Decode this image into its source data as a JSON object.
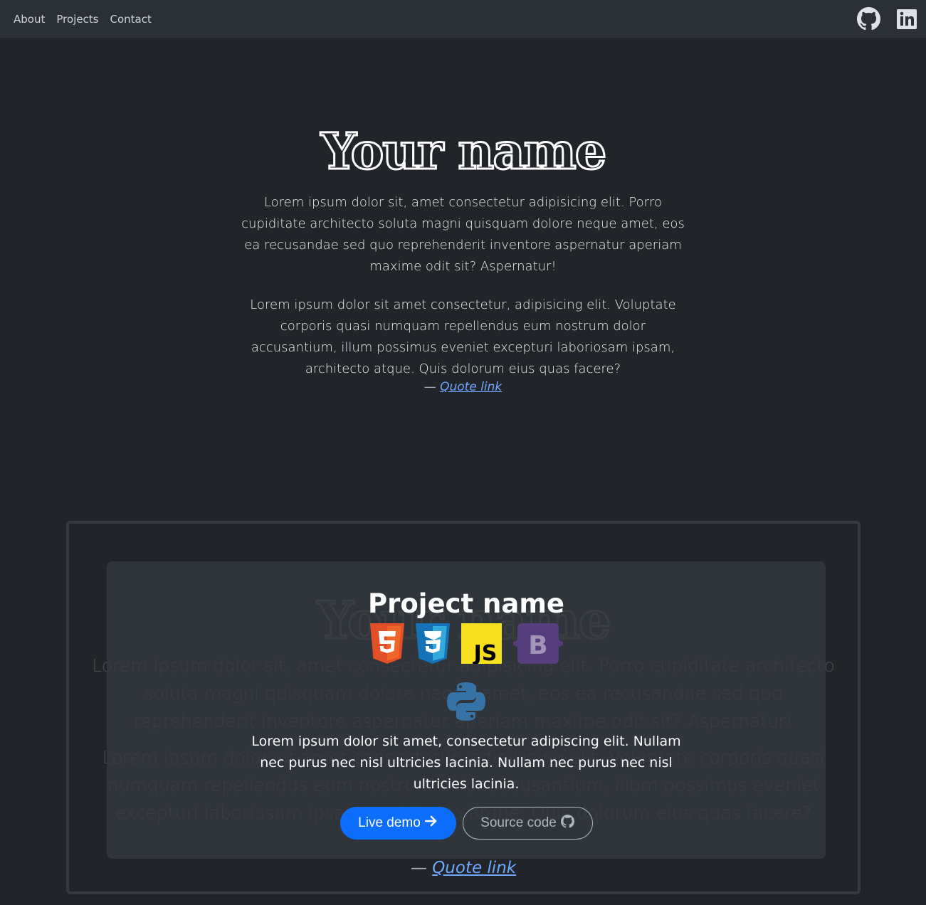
{
  "nav": {
    "links": [
      "About",
      "Projects",
      "Contact"
    ],
    "icons": [
      "github-icon",
      "linkedin-icon"
    ]
  },
  "hero": {
    "name": "Your name",
    "paragraph1": "Lorem ipsum dolor sit, amet consectetur adipisicing elit. Porro cupiditate architecto soluta magni quisquam dolore neque amet, eos ea recusandae sed quo reprehenderit inventore aspernatur aperiam maxime odit sit? Aspernatur!",
    "paragraph2": "Lorem ipsum dolor sit amet consectetur, adipisicing elit. Voluptate corporis quasi numquam repellendus eum nostrum dolor accusantium, illum possimus eveniet excepturi laboriosam ipsam, architecto atque. Quis dolorum eius quas facere?",
    "quote_dash": "—",
    "quote_link": "Quote link"
  },
  "project": {
    "title": "Project name",
    "tech_icons": [
      "html5-icon",
      "css3-icon",
      "javascript-icon",
      "bootstrap-icon",
      "python-icon"
    ],
    "description": "Lorem ipsum dolor sit amet, consectetur adipiscing elit. Nullam nec purus nec nisl ultricies lacinia. Nullam nec purus nec nisl ultricies lacinia.",
    "live_demo_label": "Live demo",
    "source_code_label": "Source code"
  },
  "colors": {
    "background": "#212529",
    "navbar": "#2b3035",
    "primary": "#0d6efd",
    "link": "#6ea8fe",
    "html5": "#e34f26",
    "css3": "#1572b6",
    "js": "#f7df1e",
    "bootstrap": "#563d7c",
    "python": "#3572a5"
  }
}
